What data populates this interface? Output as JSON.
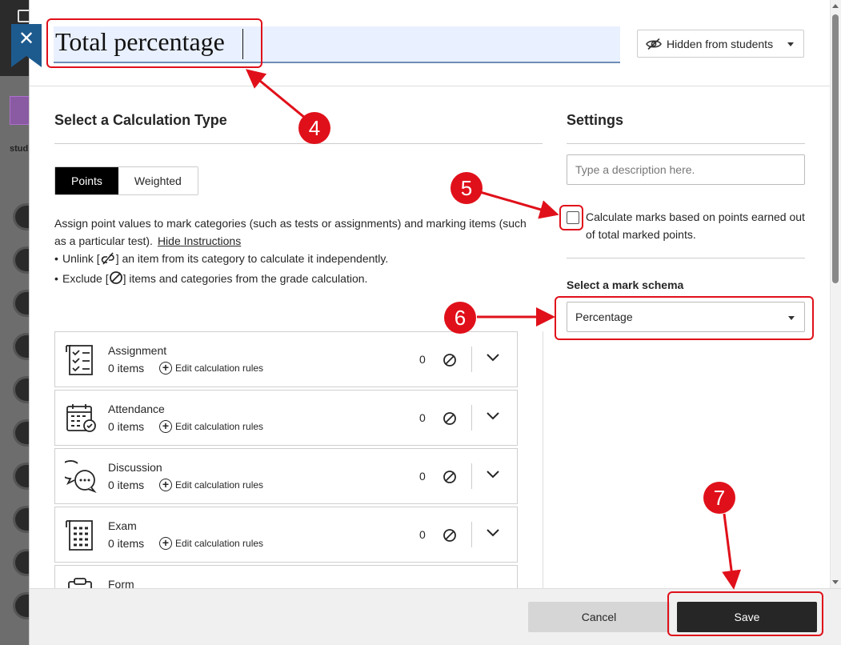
{
  "header": {
    "title": "Total percentage",
    "visibility_label": "Hidden from students",
    "background_label": "stud"
  },
  "calculation": {
    "section_title": "Select a Calculation Type",
    "tabs": [
      {
        "label": "Points",
        "active": true
      },
      {
        "label": "Weighted",
        "active": false
      }
    ],
    "instructions_text": "Assign point values to mark categories (such as tests or assignments) and marking items (such as a particular test).",
    "hide_link": "Hide Instructions",
    "bullet1_before": "Unlink [",
    "bullet1_after": "] an item from its category to calculate it independently.",
    "bullet2_before": "Exclude [",
    "bullet2_after": "] items and categories from the grade calculation.",
    "categories": [
      {
        "name": "Assignment",
        "count": "0 items",
        "rules": "Edit calculation rules",
        "value": "0",
        "icon": "assignment-icon"
      },
      {
        "name": "Attendance",
        "count": "0 items",
        "rules": "Edit calculation rules",
        "value": "0",
        "icon": "attendance-icon"
      },
      {
        "name": "Discussion",
        "count": "0 items",
        "rules": "Edit calculation rules",
        "value": "0",
        "icon": "discussion-icon"
      },
      {
        "name": "Exam",
        "count": "0 items",
        "rules": "Edit calculation rules",
        "value": "0",
        "icon": "exam-icon"
      },
      {
        "name": "Form",
        "count": "",
        "rules": "",
        "value": "",
        "icon": "form-icon"
      }
    ]
  },
  "settings": {
    "title": "Settings",
    "description_placeholder": "Type a description here.",
    "checkbox_label": "Calculate marks based on points earned out of total marked points.",
    "schema_label": "Select a mark schema",
    "schema_value": "Percentage"
  },
  "footer": {
    "cancel_label": "Cancel",
    "save_label": "Save"
  },
  "annotations": {
    "numbers": [
      "4",
      "5",
      "6",
      "7"
    ],
    "color": "#e0101a"
  },
  "colors": {
    "close_button": "#1d5b8f",
    "title_bg": "#e9f0ff",
    "save_button": "#262626"
  }
}
